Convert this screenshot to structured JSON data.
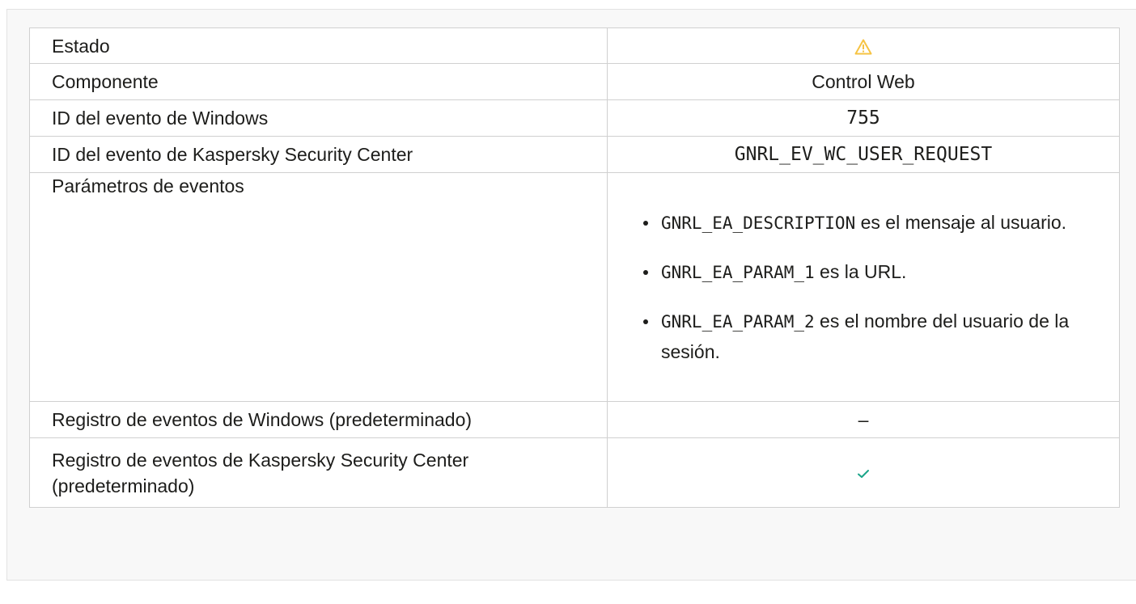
{
  "table": {
    "rows": [
      {
        "label": "Estado",
        "value_icon": "warning-icon",
        "warning_color": "#f6c343"
      },
      {
        "label": "Componente",
        "value": "Control Web"
      },
      {
        "label": "ID del evento de Windows",
        "value": "755"
      },
      {
        "label": "ID del evento de Kaspersky Security Center",
        "value": "GNRL_EV_WC_USER_REQUEST"
      },
      {
        "label": "Parámetros de eventos",
        "params": [
          {
            "code": "GNRL_EA_DESCRIPTION",
            "text": " es el mensaje al usuario."
          },
          {
            "code": "GNRL_EA_PARAM_1",
            "text": " es la URL."
          },
          {
            "code": "GNRL_EA_PARAM_2",
            "text": " es el nombre del usuario de la sesión."
          }
        ]
      },
      {
        "label": "Registro de eventos de Windows (predeterminado)",
        "value": "–",
        "value_icon": "dash-icon"
      },
      {
        "label": "Registro de eventos de Kaspersky Security Center (predeterminado)",
        "value_icon": "checkmark-icon",
        "check_color": "#1aa589"
      }
    ]
  }
}
